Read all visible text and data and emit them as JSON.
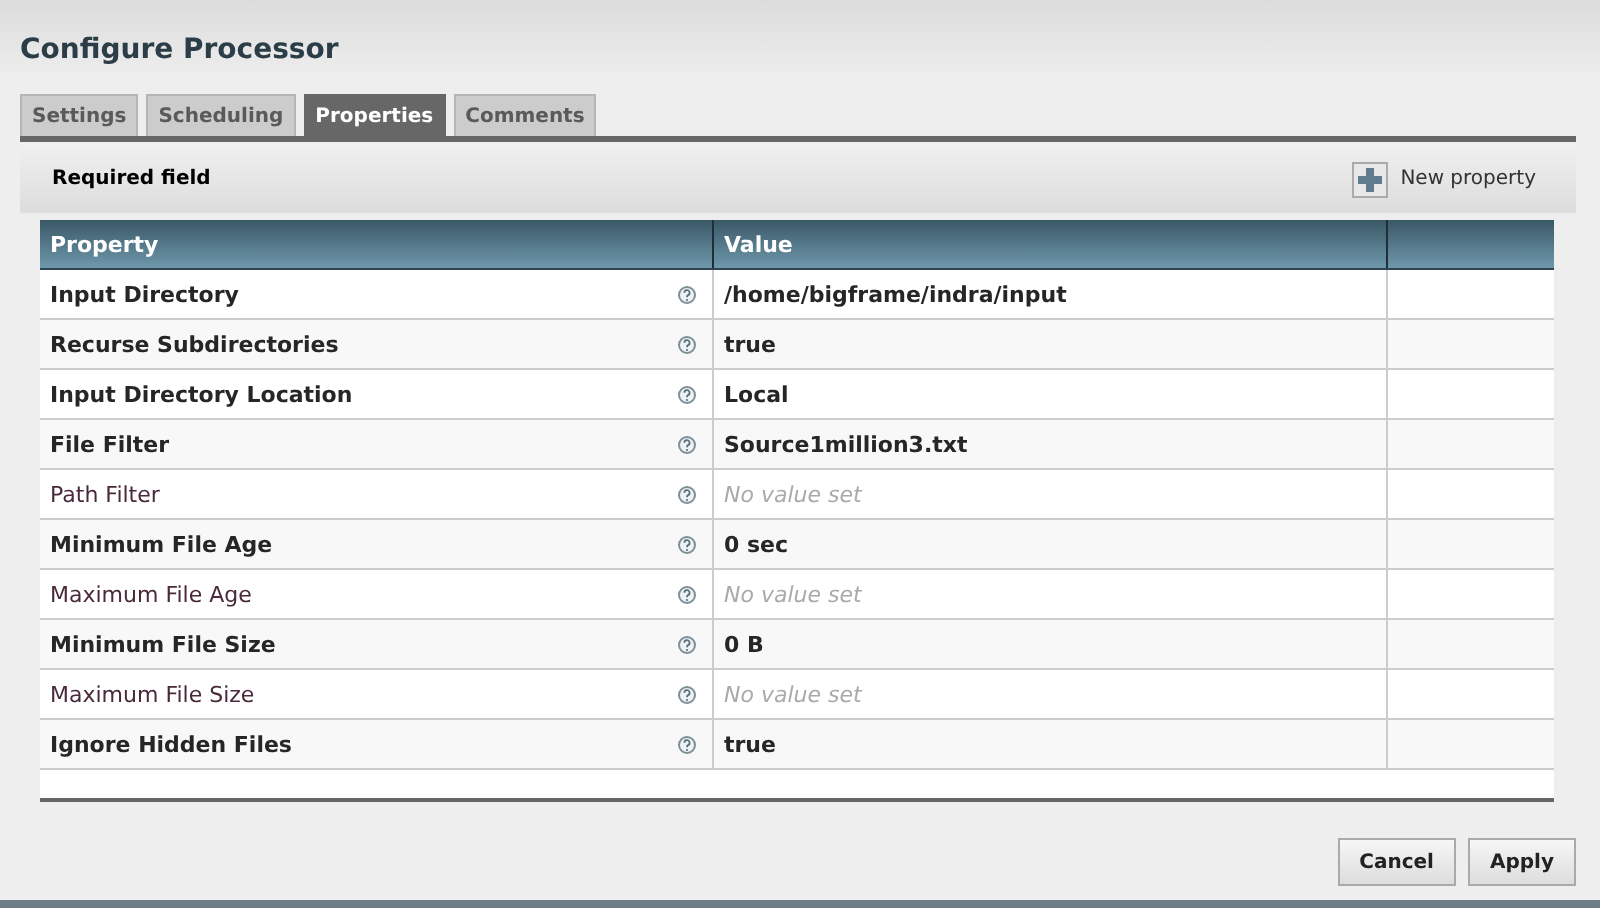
{
  "window": {
    "title": "Configure Processor"
  },
  "tabs": [
    {
      "label": "Settings",
      "selected": false
    },
    {
      "label": "Scheduling",
      "selected": false
    },
    {
      "label": "Properties",
      "selected": true
    },
    {
      "label": "Comments",
      "selected": false
    }
  ],
  "toolbar": {
    "note": "Required field",
    "new_property": "New property"
  },
  "table": {
    "columns": [
      "Property",
      "Value"
    ],
    "rows": [
      {
        "property": "Input Directory",
        "required": true,
        "value": "/home/bigframe/indra/input",
        "value_set": true
      },
      {
        "property": "Recurse Subdirectories",
        "required": true,
        "value": "true",
        "value_set": true
      },
      {
        "property": "Input Directory Location",
        "required": true,
        "value": "Local",
        "value_set": true
      },
      {
        "property": "File Filter",
        "required": true,
        "value": "Source1million3.txt",
        "value_set": true
      },
      {
        "property": "Path Filter",
        "required": false,
        "value": "No value set",
        "value_set": false
      },
      {
        "property": "Minimum File Age",
        "required": true,
        "value": "0 sec",
        "value_set": true
      },
      {
        "property": "Maximum File Age",
        "required": false,
        "value": "No value set",
        "value_set": false
      },
      {
        "property": "Minimum File Size",
        "required": true,
        "value": "0 B",
        "value_set": true
      },
      {
        "property": "Maximum File Size",
        "required": false,
        "value": "No value set",
        "value_set": false
      },
      {
        "property": "Ignore Hidden Files",
        "required": true,
        "value": "true",
        "value_set": true
      }
    ]
  },
  "buttons": [
    "Cancel",
    "Apply"
  ]
}
